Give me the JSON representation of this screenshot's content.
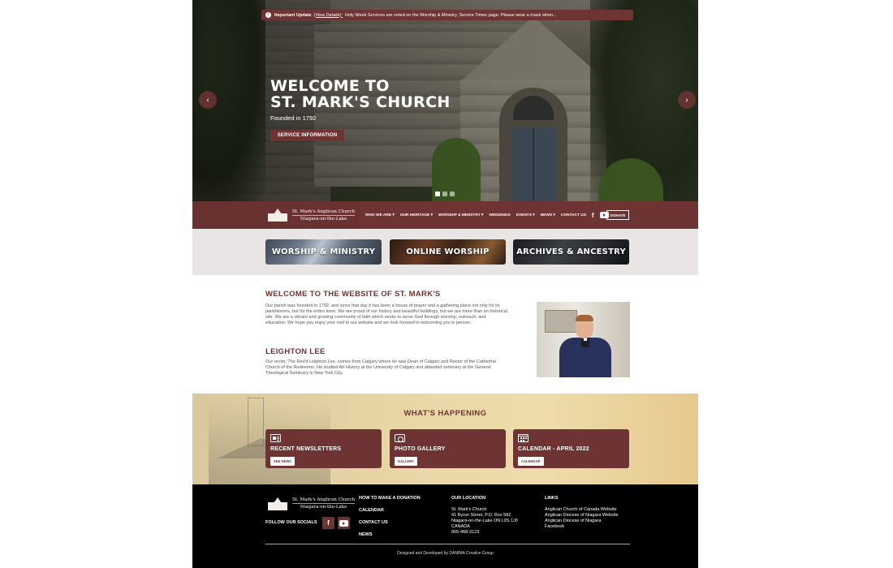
{
  "alert": {
    "label": "Important Update",
    "details_link": "(View Details):",
    "message": "Holy Week Services are noted on the Worship & Ministry, Service Times page. Please wear a mask when..."
  },
  "hero": {
    "title_line1": "WELCOME TO",
    "title_line2": "ST. MARK'S CHURCH",
    "subtitle": "Founded in 1792",
    "button": "SERVICE INFORMATION"
  },
  "logo": {
    "name": "St. Mark's Anglican Church",
    "place": "Niagara-on-the-Lake"
  },
  "nav": {
    "items": [
      "WHO WE ARE ▾",
      "OUR HERITAGE ▾",
      "WORSHIP & MINISTRY ▾",
      "WEDDINGS",
      "EVENTS ▾",
      "NEWS ▾",
      "CONTACT US"
    ],
    "donate": "DONATE"
  },
  "quick_links": [
    "WORSHIP & MINISTRY",
    "ONLINE WORSHIP",
    "ARCHIVES & ANCESTRY"
  ],
  "welcome": {
    "title": "WELCOME TO THE WEBSITE OF ST. MARK'S",
    "body": "Our parish was founded in 1792, and since that day it has been a house of prayer and a gathering place not only for its parishioners, but for the entire town. We are proud of our history and beautiful buildings, but we are more than an historical site. We are a vibrant and growing community of faith which seeks to serve God through worship, outreach, and education. We hope you enjoy your visit to our website and we look forward to welcoming you in person."
  },
  "rector": {
    "title": "LEIGHTON LEE",
    "body": "Our rector, The Rev'd Leighton Lee, comes from Calgary where he was Dean of Calgary and Rector of the Cathedral Church of the Redeemer. He studied Art History at the University of Calgary and attended seminary at the General Theological Seminary in New York City."
  },
  "happening": {
    "title": "WHAT'S HAPPENING",
    "cards": [
      {
        "title": "RECENT NEWSLETTERS",
        "button": "SEE NEWS"
      },
      {
        "title": "PHOTO GALLERY",
        "button": "GALLERY"
      },
      {
        "title": "CALENDAR - APRIL 2022",
        "button": "CALENDAR"
      }
    ]
  },
  "footer": {
    "follow": "FOLLOW OUR SOCIALS",
    "links_col": [
      "HOW TO MAKE A DONATION",
      "CALENDAR",
      "CONTACT US",
      "NEWS"
    ],
    "location_head": "OUR LOCATION",
    "location_lines": [
      "St. Mark's Church",
      "41 Byron Street, P.O. Box 582",
      "Niagara-on-the-Lake ON L0S 1J0",
      "CANADA",
      "905-468-3123"
    ],
    "links_head": "LINKS",
    "external_links": [
      "Anglican Church of Canada Website",
      "Anglican Diocese of Niagara Website",
      "Anglican Diocese of Niagara",
      "Facebook"
    ],
    "credit": "Designed and Developed by DANIMA Creative Group"
  },
  "colors": {
    "brand": "#6e3434",
    "quick_bg": "#eae5e5",
    "footer_bg": "#000000"
  }
}
